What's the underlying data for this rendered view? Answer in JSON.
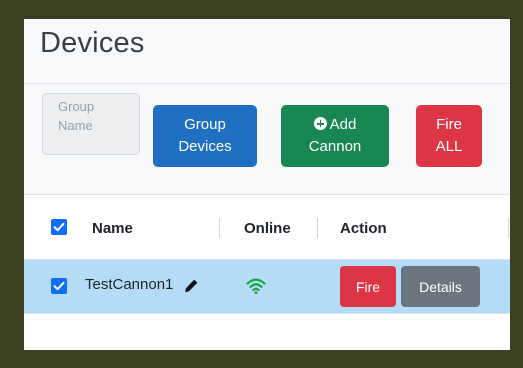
{
  "page": {
    "title": "Devices"
  },
  "toolbar": {
    "group_name_placeholder": "Group Name",
    "group_devices_label": "Group Devices",
    "add_cannon_label": "Add Cannon",
    "fire_all_label": "Fire ALL"
  },
  "table": {
    "headers": {
      "name": "Name",
      "online": "Online",
      "action": "Action"
    },
    "rows": [
      {
        "name": "TestCannon1",
        "selected": true,
        "online": true,
        "fire_label": "Fire",
        "details_label": "Details"
      }
    ]
  },
  "icons": {
    "select_all": "checkbox-checked-icon",
    "add": "plus-circle-icon",
    "edit": "pencil-icon",
    "online": "wifi-icon"
  },
  "colors": {
    "frame": "#3a4020",
    "primary": "#1f6fc3",
    "success": "#198754",
    "danger": "#dc3545",
    "secondary": "#6c757d",
    "row_selected": "#b5dcf7",
    "checkbox": "#0d6efd",
    "online": "#1aa843"
  }
}
